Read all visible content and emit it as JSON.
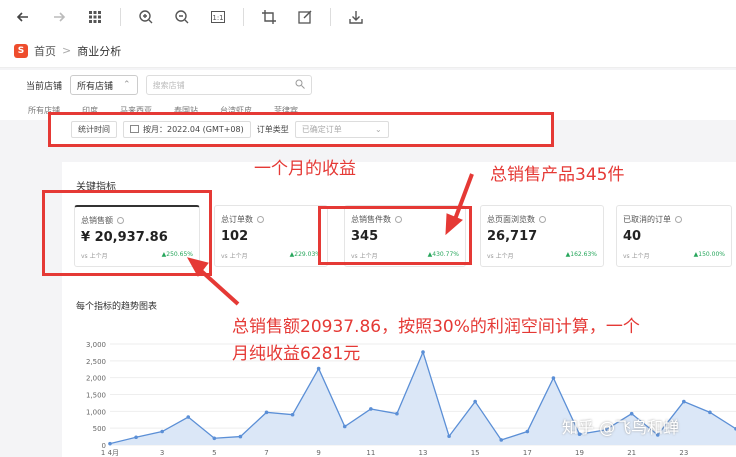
{
  "toolbar": {
    "icons": [
      "back-arrow-icon",
      "forward-arrow-icon",
      "grid-icon",
      "zoom-in-icon",
      "zoom-out-icon",
      "actual-size-icon",
      "crop-icon",
      "edit-icon",
      "save-icon"
    ]
  },
  "breadcrumb": {
    "home": "首页",
    "sep": ">",
    "current": "商业分析"
  },
  "filter": {
    "label": "当前店铺",
    "selected": "所有店铺",
    "search_placeholder": "搜索店铺"
  },
  "shop_tabs": [
    "所有店铺",
    "印度",
    "马来西亚",
    "泰国站",
    "台湾虾皮",
    "菲律宾"
  ],
  "stats": {
    "time_label": "统计时间",
    "period": "按月：2022.04 (GMT+08)",
    "order_type_label": "订单类型",
    "order_type_value": "已确定订单"
  },
  "section": {
    "title": "关键指标",
    "chart_title": "每个指标的趋势图表"
  },
  "cards": [
    {
      "label": "总销售额",
      "value": "¥ 20,937.86",
      "compare": "vs 上个月",
      "change": "250.65%"
    },
    {
      "label": "总订单数",
      "value": "102",
      "compare": "vs 上个月",
      "change": "229.03%"
    },
    {
      "label": "总销售件数",
      "value": "345",
      "compare": "vs 上个月",
      "change": "430.77%"
    },
    {
      "label": "总页面浏览数",
      "value": "26,717",
      "compare": "vs 上个月",
      "change": "162.63%"
    },
    {
      "label": "已取消的订单",
      "value": "40",
      "compare": "vs 上个月",
      "change": "150.00%"
    }
  ],
  "annotations": {
    "a1": "一个月的收益",
    "a2": "总销售产品345件",
    "a3_line1": "总销售额20937.86，按照30%的利润空间计算，一个",
    "a3_line2": "月纯收益6281元"
  },
  "watermark": "知乎 @飞鸟和蝉",
  "chart_data": {
    "type": "area",
    "x": [
      1,
      2,
      3,
      4,
      5,
      6,
      7,
      8,
      9,
      10,
      11,
      12,
      13,
      14,
      15,
      16,
      17,
      18,
      19,
      20,
      21,
      22,
      23,
      24,
      25
    ],
    "x_tick_labels": [
      "1 4月",
      "3",
      "5",
      "7",
      "9",
      "11",
      "13",
      "15",
      "17",
      "19",
      "21",
      "23"
    ],
    "values": [
      40,
      230,
      400,
      830,
      200,
      250,
      970,
      900,
      2270,
      550,
      1070,
      930,
      2760,
      260,
      1290,
      150,
      400,
      1990,
      320,
      450,
      930,
      300,
      1290,
      970,
      480
    ],
    "ylim": [
      0,
      3000
    ],
    "y_ticks": [
      "3,000",
      "2,500",
      "2,000",
      "1,500",
      "1,000",
      "500",
      "0"
    ],
    "color": "#5b8fd6"
  }
}
